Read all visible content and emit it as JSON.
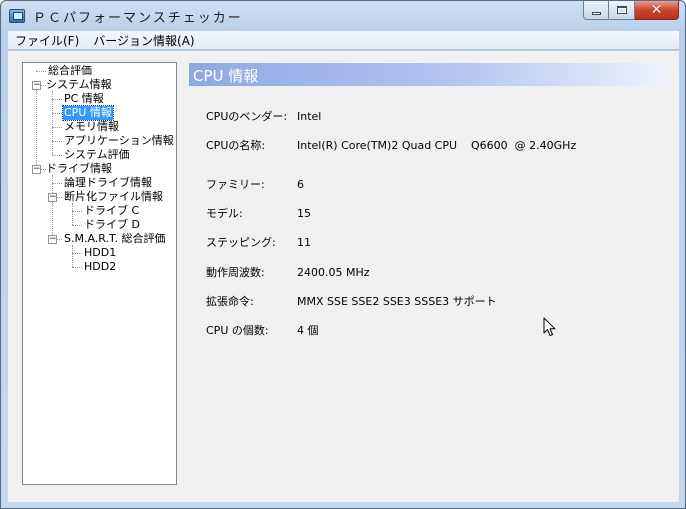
{
  "window": {
    "title": "ＰＣパフォーマンスチェッカー",
    "controls": {
      "minimize": "minimize",
      "maximize": "maximize",
      "close": "✕"
    }
  },
  "menu": [
    {
      "label": "ファイル(F)"
    },
    {
      "label": "バージョン情報(A)"
    }
  ],
  "tree": {
    "items": [
      {
        "label": "総合評価"
      },
      {
        "label": "システム情報",
        "expander": "−"
      },
      {
        "label": "PC 情報"
      },
      {
        "label": "CPU 情報",
        "selected": true
      },
      {
        "label": "メモリ情報"
      },
      {
        "label": "アプリケーション情報"
      },
      {
        "label": "システム評価"
      },
      {
        "label": "ドライブ情報",
        "expander": "−"
      },
      {
        "label": "論理ドライブ情報"
      },
      {
        "label": "断片化ファイル情報",
        "expander": "−"
      },
      {
        "label": "ドライブ C"
      },
      {
        "label": "ドライブ D"
      },
      {
        "label": "S.M.A.R.T. 総合評価",
        "expander": "−"
      },
      {
        "label": "HDD1"
      },
      {
        "label": "HDD2"
      }
    ]
  },
  "panel": {
    "title": "CPU 情報",
    "header_colors": [
      "#8fa7e4",
      "#eef2fc"
    ],
    "rows": [
      {
        "label": "CPUのベンダー:",
        "value": "Intel"
      },
      {
        "label": "CPUの名称:",
        "value": "Intel(R) Core(TM)2 Quad CPU    Q6600  @ 2.40GHz"
      },
      {
        "label": "ファミリー:",
        "value": "6"
      },
      {
        "label": "モデル:",
        "value": "15"
      },
      {
        "label": "ステッピング:",
        "value": "11"
      },
      {
        "label": "動作周波数:",
        "value": "2400.05 MHz"
      },
      {
        "label": "拡張命令:",
        "value": "MMX SSE SSE2 SSE3 SSSE3 サポート"
      },
      {
        "label": "CPU の個数:",
        "value": "4 個"
      }
    ]
  },
  "icons": {
    "app": "app-monitor-icon",
    "cursor": "mouse-pointer-icon"
  }
}
